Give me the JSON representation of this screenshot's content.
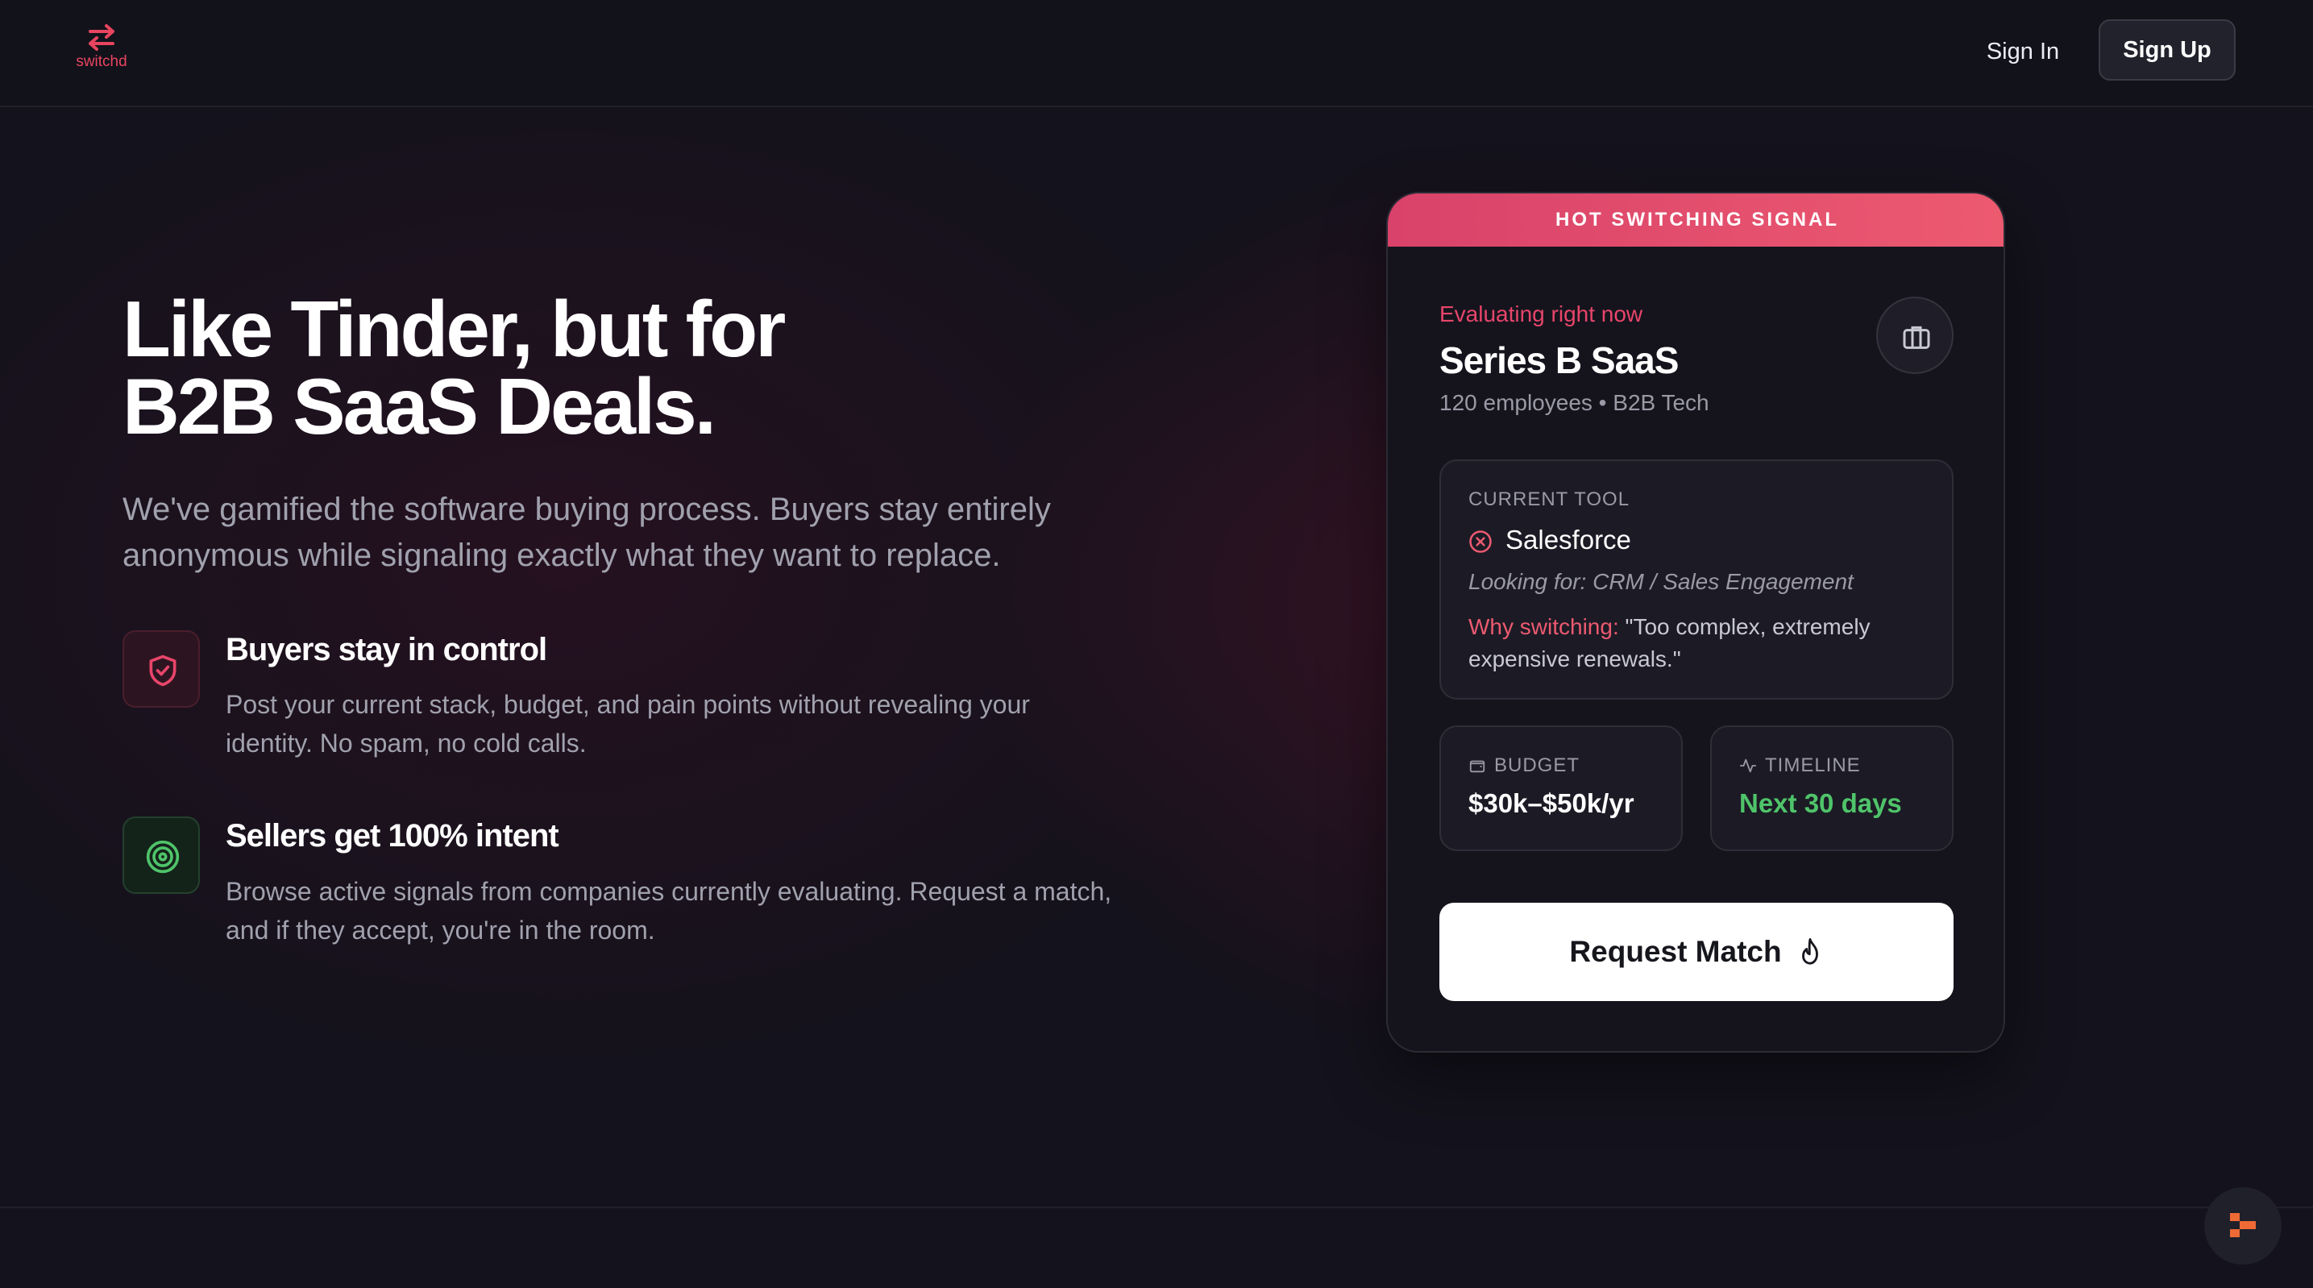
{
  "header": {
    "logo_text": "switchd",
    "sign_in": "Sign In",
    "sign_up": "Sign Up"
  },
  "hero": {
    "title_line1": "Like Tinder, but for",
    "title_line2": "B2B SaaS Deals.",
    "subtitle": "We've gamified the software buying process. Buyers stay entirely anonymous while signaling exactly what they want to replace."
  },
  "features": [
    {
      "title": "Buyers stay in control",
      "description": "Post your current stack, budget, and pain points without revealing your identity. No spam, no cold calls.",
      "icon": "shield-check-icon"
    },
    {
      "title": "Sellers get 100% intent",
      "description": "Browse active signals from companies currently evaluating. Request a match, and if they accept, you're in the room.",
      "icon": "target-icon"
    }
  ],
  "card": {
    "banner": "HOT SWITCHING SIGNAL",
    "status": "Evaluating right now",
    "company": "Series B SaaS",
    "meta": "120 employees • B2B Tech",
    "current_tool_label": "CURRENT TOOL",
    "current_tool": "Salesforce",
    "looking_for": "Looking for: CRM / Sales Engagement",
    "why_label": "Why switching:",
    "why_text": " \"Too complex, extremely expensive renewals.\"",
    "budget_label": "BUDGET",
    "budget_value": "$30k–$50k/yr",
    "timeline_label": "TIMELINE",
    "timeline_value": "Next 30 days",
    "cta": "Request Match"
  },
  "colors": {
    "accent": "#e8456a",
    "banner_start": "#d9426a",
    "banner_end": "#ec5a70",
    "success": "#4fc46a",
    "background": "#14121c"
  }
}
